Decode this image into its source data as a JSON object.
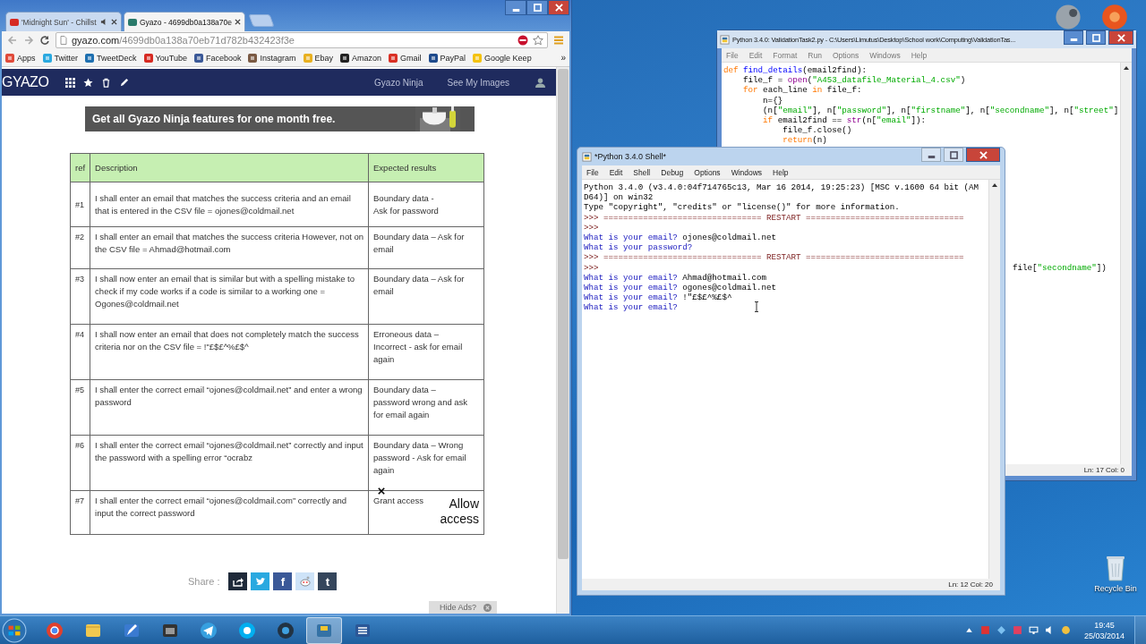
{
  "browser": {
    "tabs": [
      {
        "title": "'Midnight Sun' - Chillst",
        "selected": false,
        "audio": true
      },
      {
        "title": "Gyazo - 4699db0a138a70e",
        "selected": true,
        "audio": false
      }
    ],
    "address": {
      "domain": "gyazo.com",
      "path": "/4699db0a138a70eb71d782b432423f3e"
    },
    "bookmarks": [
      {
        "label": "Apps",
        "kind": "apps"
      },
      {
        "label": "Twitter",
        "kind": "twitter"
      },
      {
        "label": "TweetDeck",
        "kind": "tweetdeck"
      },
      {
        "label": "YouTube",
        "kind": "youtube"
      },
      {
        "label": "Facebook",
        "kind": "facebook"
      },
      {
        "label": "Instagram",
        "kind": "instagram"
      },
      {
        "label": "Ebay",
        "kind": "ebay"
      },
      {
        "label": "Amazon",
        "kind": "amazon"
      },
      {
        "label": "Gmail",
        "kind": "gmail"
      },
      {
        "label": "PayPal",
        "kind": "paypal"
      },
      {
        "label": "Google Keep",
        "kind": "keep"
      }
    ],
    "more": "»"
  },
  "gyazo": {
    "logo": "GYAZO",
    "nav": [
      "Gyazo Ninja",
      "See My Images"
    ],
    "banner": "Get all Gyazo Ninja features for one month free.",
    "table": {
      "columns": [
        "ref",
        "Description",
        "Expected results"
      ],
      "rows": [
        {
          "ref": "#1",
          "description": "I shall enter an email that matches the success criteria and an email that is entered in the CSV file = ojones@coldmail.net",
          "expected": "Boundary data -\nAsk for password",
          "crossed_out": false
        },
        {
          "ref": "#2",
          "description": "I shall enter an email that matches the success criteria However, not on the CSV file = Ahmad@hotmail.com",
          "expected": "Boundary data – Ask for email",
          "crossed_out": false
        },
        {
          "ref": "#3",
          "description": "I shall now enter an email that is similar but with a spelling mistake to check if my code works if a code is similar to a working one = Ogones@coldmail.net",
          "expected": "Boundary data – Ask for email",
          "crossed_out": false
        },
        {
          "ref": "#4",
          "description": "I shall now enter an email that does not completely match the success criteria nor on the CSV file = !\"£$£^%£$^",
          "expected": "Erroneous data –\nIncorrect - ask for email again",
          "crossed_out": false
        },
        {
          "ref": "#5",
          "description": "I shall enter the correct email “ojones@coldmail.net” and enter a wrong password",
          "expected": "Boundary data –\npassword wrong and ask for email again",
          "crossed_out": false
        },
        {
          "ref": "#6",
          "description": "I shall enter the correct email “ojones@coldmail.net” correctly and input the password with a spelling error “ocrabz",
          "expected": "Boundary data –  Wrong password - Ask for email again",
          "crossed_out": false
        },
        {
          "ref": "#7",
          "description": "I shall enter the correct email “ojones@coldmail.com” correctly and input the correct password",
          "expected": "Grant access",
          "crossed_out": true,
          "correction": "Allow access"
        }
      ]
    },
    "share": {
      "label": "Share :",
      "buttons": [
        {
          "kind": "share"
        },
        {
          "kind": "twitter"
        },
        {
          "kind": "facebook",
          "glyph": "f"
        },
        {
          "kind": "reddit"
        },
        {
          "kind": "tumblr",
          "glyph": "t"
        }
      ]
    },
    "hide_ads": "Hide Ads?"
  },
  "editor": {
    "title": "Python 3.4.0: ValidationTask2.py - C:\\Users\\Limutus\\Desktop\\School work\\Computing\\ValidationTas...",
    "menu": [
      "File",
      "Edit",
      "Format",
      "Run",
      "Options",
      "Windows",
      "Help"
    ],
    "lines": [
      [
        {
          "kind": "keyword",
          "text": "def"
        },
        {
          "kind": "defname",
          "text": " find_details"
        },
        {
          "kind": "plain",
          "text": "(email2find):"
        }
      ],
      [
        {
          "kind": "plain",
          "text": "    file_f = "
        },
        {
          "kind": "builtin",
          "text": "open"
        },
        {
          "kind": "plain",
          "text": "("
        },
        {
          "kind": "string",
          "text": "\"A453_datafile_Material_4.csv\""
        },
        {
          "kind": "plain",
          "text": ")"
        }
      ],
      [
        {
          "kind": "keyword",
          "text": "    for"
        },
        {
          "kind": "plain",
          "text": " each_line "
        },
        {
          "kind": "keyword",
          "text": "in"
        },
        {
          "kind": "plain",
          "text": " file_f:"
        }
      ],
      [
        {
          "kind": "plain",
          "text": "        n={}"
        }
      ],
      [
        {
          "kind": "plain",
          "text": "        (n["
        },
        {
          "kind": "string",
          "text": "\"email\""
        },
        {
          "kind": "plain",
          "text": "], n["
        },
        {
          "kind": "string",
          "text": "\"password\""
        },
        {
          "kind": "plain",
          "text": "], n["
        },
        {
          "kind": "string",
          "text": "\"firstname\""
        },
        {
          "kind": "plain",
          "text": "], n["
        },
        {
          "kind": "string",
          "text": "\"secondname\""
        },
        {
          "kind": "plain",
          "text": "], n["
        },
        {
          "kind": "string",
          "text": "\"street\""
        },
        {
          "kind": "plain",
          "text": "]"
        }
      ],
      [
        {
          "kind": "keyword",
          "text": "        if"
        },
        {
          "kind": "plain",
          "text": " email2find == "
        },
        {
          "kind": "builtin",
          "text": "str"
        },
        {
          "kind": "plain",
          "text": "(n["
        },
        {
          "kind": "string",
          "text": "\"email\""
        },
        {
          "kind": "plain",
          "text": "]):"
        }
      ],
      [
        {
          "kind": "plain",
          "text": "            file_f.close()"
        }
      ],
      [
        {
          "kind": "keyword",
          "text": "            return"
        },
        {
          "kind": "plain",
          "text": "(n)"
        }
      ]
    ],
    "fragment": [
      {
        "kind": "plain",
        "text": "file["
      },
      {
        "kind": "string",
        "text": "\"secondname\""
      },
      {
        "kind": "plain",
        "text": "])"
      }
    ],
    "status": "Ln: 17 Col: 0"
  },
  "shell": {
    "title": "*Python 3.4.0 Shell*",
    "menu": [
      "File",
      "Edit",
      "Shell",
      "Debug",
      "Options",
      "Windows",
      "Help"
    ],
    "lines": [
      [
        {
          "kind": "output",
          "text": "Python 3.4.0 (v3.4.0:04f714765c13, Mar 16 2014, 19:25:23) [MSC v.1600 64 bit (AM"
        }
      ],
      [
        {
          "kind": "output",
          "text": "D64)] on win32"
        }
      ],
      [
        {
          "kind": "output",
          "text": "Type \"copyright\", \"credits\" or \"license()\" for more information."
        }
      ],
      [
        {
          "kind": "prompt",
          "text": ">>> ================================ RESTART ================================"
        }
      ],
      [
        {
          "kind": "prompt",
          "text": ">>>"
        }
      ],
      [
        {
          "kind": "stdout",
          "text": "What is your email?"
        },
        {
          "kind": "input",
          "text": " ojones@coldmail.net"
        }
      ],
      [
        {
          "kind": "stdout",
          "text": "What is your password?"
        }
      ],
      [
        {
          "kind": "prompt",
          "text": ">>> ================================ RESTART ================================"
        }
      ],
      [
        {
          "kind": "prompt",
          "text": ">>>"
        }
      ],
      [
        {
          "kind": "stdout",
          "text": "What is your email?"
        },
        {
          "kind": "input",
          "text": " Ahmad@hotmail.com"
        }
      ],
      [
        {
          "kind": "stdout",
          "text": "What is your email?"
        },
        {
          "kind": "input",
          "text": " ogones@coldmail.net"
        }
      ],
      [
        {
          "kind": "stdout",
          "text": "What is your email?"
        },
        {
          "kind": "input",
          "text": " !\"£$£^%£$^"
        }
      ],
      [
        {
          "kind": "stdout",
          "text": "What is your email?"
        }
      ]
    ],
    "status": "Ln: 12 Col: 20"
  },
  "desktop": {
    "icons": [
      {
        "label": "Recycle Bin"
      }
    ]
  },
  "taskbar": {
    "apps": [
      {
        "kind": "chrome",
        "selected": false
      },
      {
        "kind": "folder",
        "selected": false
      },
      {
        "kind": "pen",
        "selected": false
      },
      {
        "kind": "film",
        "selected": false
      },
      {
        "kind": "telegram",
        "selected": false
      },
      {
        "kind": "skype",
        "selected": false
      },
      {
        "kind": "camera",
        "selected": false
      },
      {
        "kind": "python",
        "selected": true
      },
      {
        "kind": "word",
        "selected": false
      }
    ],
    "time": "19:45",
    "date": "25/03/2014"
  }
}
